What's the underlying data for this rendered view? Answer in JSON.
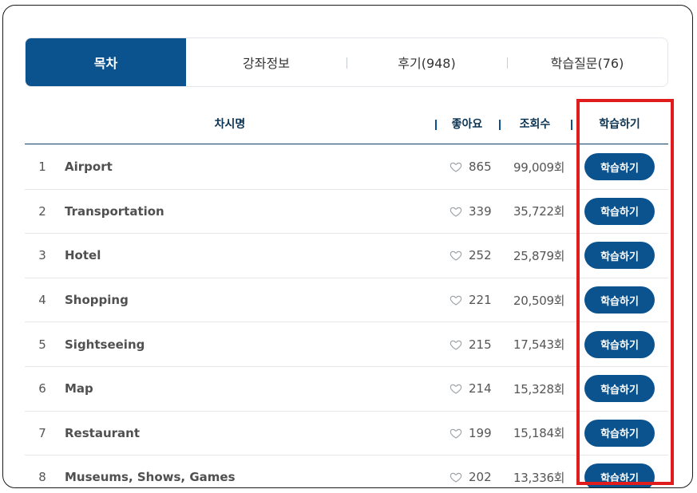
{
  "tabs": [
    {
      "label": "목차",
      "active": true
    },
    {
      "label": "강좌정보",
      "active": false
    },
    {
      "label": "후기(948)",
      "active": false
    },
    {
      "label": "학습질문(76)",
      "active": false
    }
  ],
  "table": {
    "headers": {
      "title": "차시명",
      "likes": "좋아요",
      "views": "조회수",
      "study": "학습하기"
    },
    "rows": [
      {
        "num": "1",
        "title": "Airport",
        "likes": "865",
        "views": "99,009회",
        "button": "학습하기"
      },
      {
        "num": "2",
        "title": "Transportation",
        "likes": "339",
        "views": "35,722회",
        "button": "학습하기"
      },
      {
        "num": "3",
        "title": "Hotel",
        "likes": "252",
        "views": "25,879회",
        "button": "학습하기"
      },
      {
        "num": "4",
        "title": "Shopping",
        "likes": "221",
        "views": "20,509회",
        "button": "학습하기"
      },
      {
        "num": "5",
        "title": "Sightseeing",
        "likes": "215",
        "views": "17,543회",
        "button": "학습하기"
      },
      {
        "num": "6",
        "title": "Map",
        "likes": "214",
        "views": "15,328회",
        "button": "학습하기"
      },
      {
        "num": "7",
        "title": "Restaurant",
        "likes": "199",
        "views": "15,184회",
        "button": "학습하기"
      },
      {
        "num": "8",
        "title": "Museums, Shows, Games",
        "likes": "202",
        "views": "13,336회",
        "button": "학습하기"
      }
    ]
  },
  "colors": {
    "accent": "#0b538e",
    "highlight": "#e11c1c"
  }
}
